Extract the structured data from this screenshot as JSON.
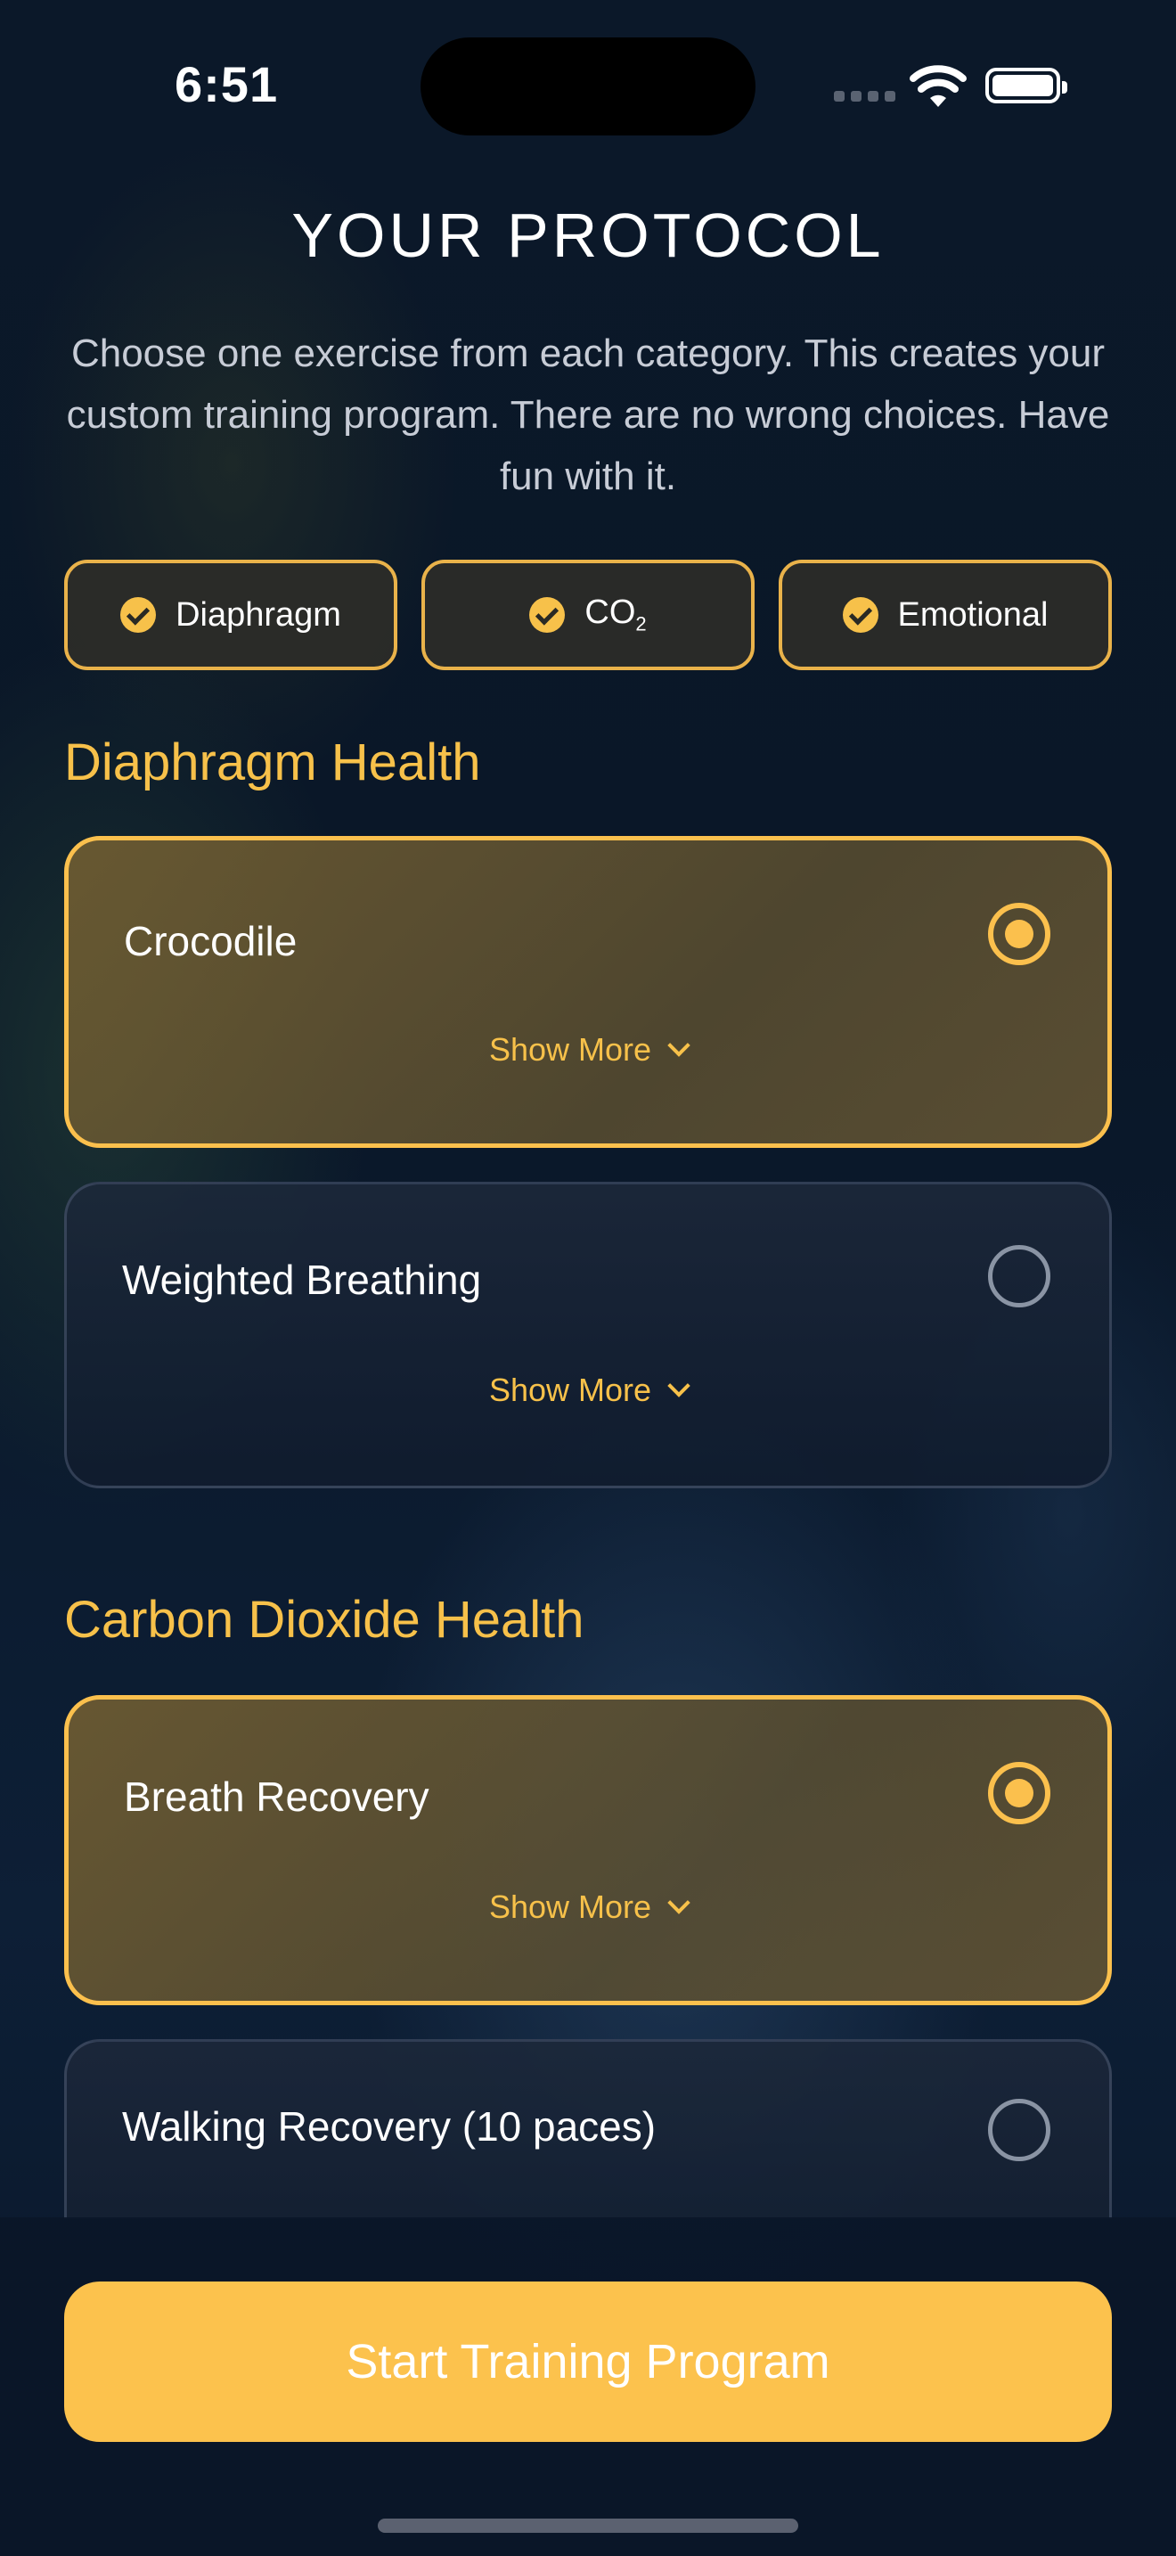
{
  "status": {
    "time": "6:51"
  },
  "header": {
    "title": "YOUR PROTOCOL",
    "subtitle": "Choose one exercise from each category. This creates your custom training program. There are no wrong choices. Have fun with it."
  },
  "chips": [
    {
      "label": "Diaphragm"
    },
    {
      "label": "CO",
      "sub": "2"
    },
    {
      "label": "Emotional"
    }
  ],
  "sections": [
    {
      "title": "Diaphragm Health",
      "options": [
        {
          "label": "Crocodile",
          "selected": true,
          "more": "Show More"
        },
        {
          "label": "Weighted Breathing",
          "selected": false,
          "more": "Show More"
        }
      ]
    },
    {
      "title": "Carbon Dioxide Health",
      "options": [
        {
          "label": "Breath Recovery",
          "selected": true,
          "more": "Show More"
        },
        {
          "label": "Walking Recovery (10 paces)",
          "selected": false
        }
      ]
    }
  ],
  "cta": {
    "label": "Start Training Program"
  },
  "colors": {
    "accent": "#fcc24d",
    "background": "#0a1628"
  }
}
